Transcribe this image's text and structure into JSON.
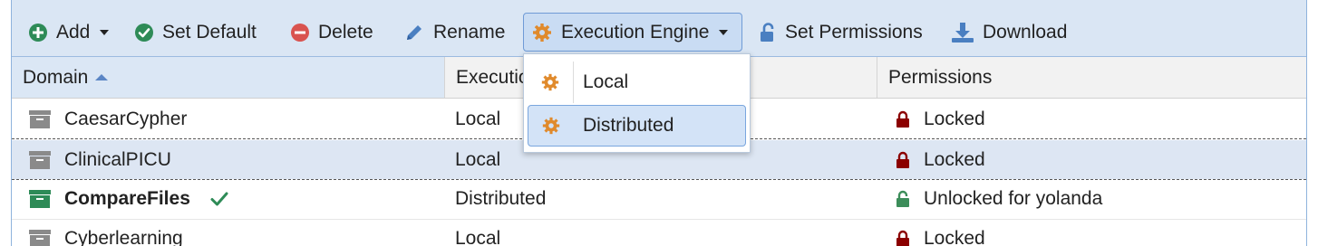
{
  "toolbar": {
    "add": "Add",
    "set_default": "Set Default",
    "delete": "Delete",
    "rename": "Rename",
    "execution_engine": "Execution Engine",
    "set_permissions": "Set Permissions",
    "download": "Download"
  },
  "table": {
    "columns": [
      "Domain",
      "Executio",
      "",
      "Permissions"
    ],
    "rows": [
      {
        "domain": "CaesarCypher",
        "engine": "Local",
        "permission": "Locked"
      },
      {
        "domain": "ClinicalPICU",
        "engine": "Local",
        "permission": "Locked"
      },
      {
        "domain": "CompareFiles",
        "engine": "Distributed",
        "permission": "Unlocked for yolanda"
      },
      {
        "domain": "Cyberlearning",
        "engine": "Local",
        "permission": "Locked"
      }
    ]
  },
  "dropdown": {
    "items": [
      "Local",
      "Distributed"
    ]
  },
  "colors": {
    "toolbar_bg": "#dae6f4",
    "selected_row": "#dde6f3",
    "add_green": "#2e8b57",
    "delete_red": "#d9534f",
    "gear_orange": "#e08a2c",
    "lock_red": "#8b0000",
    "unlock_green": "#3c8d5a"
  }
}
